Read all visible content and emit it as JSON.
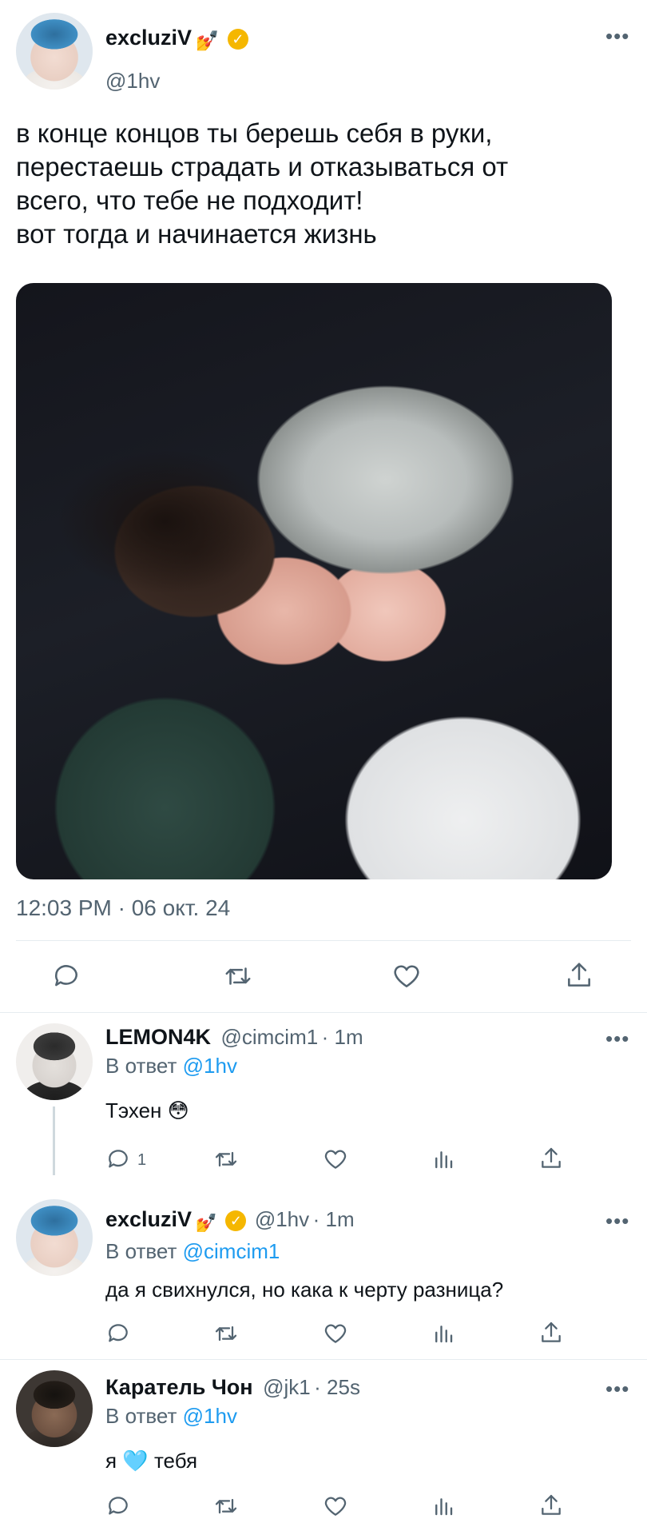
{
  "main_tweet": {
    "author_name": "excluziV",
    "author_emoji": "💅",
    "verified_badge": "✓",
    "handle": "@1hv",
    "text_lines": [
      "в конце концов ты берешь себя в руки,",
      "перестаешь страдать и отказываться от",
      "всего, что тебе не подходит!",
      "вот тогда и начинается жизнь"
    ],
    "timestamp": "12:03 PM · 06 окт. 24",
    "more": "•••",
    "actions": [
      "reply-icon",
      "retweet-icon",
      "like-icon",
      "share-icon"
    ]
  },
  "replies": [
    {
      "author_name": "LEMON4K",
      "handle": "@cimcim1",
      "time": "· 1m",
      "reply_prefix": "В ответ",
      "reply_to": "@1hv",
      "text": "Тэхен 😳",
      "reply_count": "1",
      "more": "•••"
    },
    {
      "author_name": "excluziV",
      "author_emoji": "💅",
      "verified_badge": "✓",
      "handle": "@1hv",
      "time": "· 1m",
      "reply_prefix": "В ответ",
      "reply_to": "@cimcim1",
      "text": "да я свихнулся, но кака к черту разница?",
      "more": "•••"
    },
    {
      "author_name": "Каратель Чон",
      "handle": "@jk1",
      "time": "· 25s",
      "reply_prefix": "В ответ",
      "reply_to": "@1hv",
      "text_before": "я",
      "text_emoji": "🩵",
      "text_after": "тебя",
      "more": "•••"
    }
  ],
  "colors": {
    "link": "#1d9bf0",
    "muted": "#536471",
    "verified": "#f5b700",
    "divider": "#e6ecf0"
  }
}
